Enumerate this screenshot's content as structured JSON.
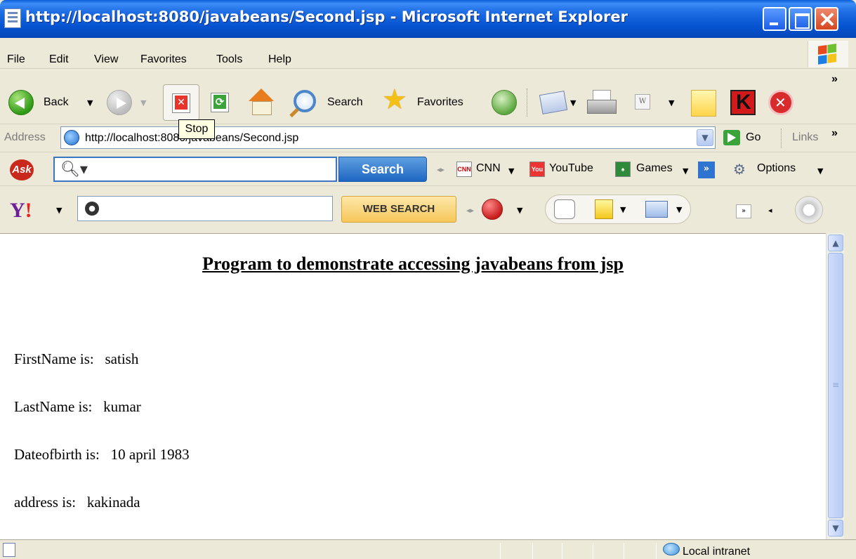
{
  "window": {
    "title": "http://localhost:8080/javabeans/Second.jsp - Microsoft Internet Explorer"
  },
  "menu": [
    "File",
    "Edit",
    "View",
    "Favorites",
    "Tools",
    "Help"
  ],
  "toolbar": {
    "back_label": "Back",
    "search_label": "Search",
    "favorites_label": "Favorites",
    "more_label": "»",
    "tooltip": "Stop"
  },
  "address_bar": {
    "label": "Address",
    "url": "http://localhost:8080/javabeans/Second.jsp",
    "go_label": "Go",
    "links_label": "Links"
  },
  "ask_toolbar": {
    "search_button": "Search",
    "cnn_label": "CNN",
    "youtube_label": "YouTube",
    "games_label": "Games",
    "options_label": "Options"
  },
  "yahoo_toolbar": {
    "web_search_button": "WEB SEARCH"
  },
  "page": {
    "heading": "Program to demonstrate accessing javabeans from jsp",
    "rows": [
      "FirstName is:   satish",
      "LastName is:   kumar",
      "Dateofbirth is:   10 april 1983",
      "address is:   kakinada"
    ]
  },
  "status_bar": {
    "zone": "Local intranet"
  },
  "icons": {
    "stop": "stop-icon",
    "refresh": "refresh-icon",
    "home": "home-icon"
  }
}
